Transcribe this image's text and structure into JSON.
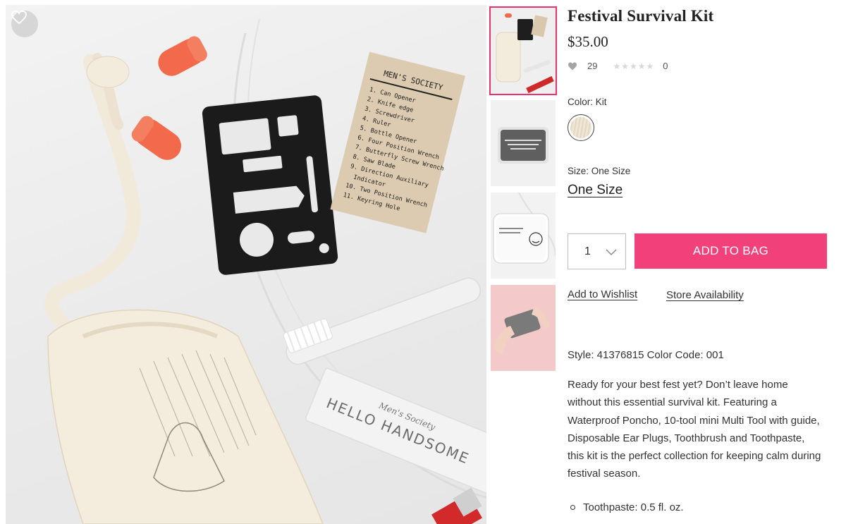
{
  "product": {
    "title": "Festival Survival Kit",
    "price": "$35.00",
    "likes": "29",
    "rating_stars": "★★★★★",
    "review_count": "0",
    "color_label": "Color: Kit",
    "size_label": "Size: One Size",
    "size_value": "One Size",
    "quantity": "1",
    "add_to_bag": "ADD TO BAG",
    "add_to_wishlist": "Add to Wishlist",
    "store_availability": "Store Availability",
    "style_line": "Style: 41376815 Color Code: 001",
    "description": "Ready for your best fest yet? Don’t leave home without this essential survival kit. Featuring a Waterproof Poncho, 10-tool mini Multi Tool with guide, Disposable Ear Plugs, Toothbrush and Toothpaste, this kit is the perfect collection for keeping calm during festival season.",
    "bullets": [
      "Toothpaste: 0.5 fl. oz."
    ]
  },
  "photo": {
    "card_title": "MEN'S SOCIETY",
    "card_items": [
      "1. Can Opener",
      "2. Knife edge",
      "3. Screwdriver",
      "4. Ruler",
      "5. Bottle Opener",
      "6. Four Position Wrench",
      "7. Butterfly Screw Wrench",
      "8. Saw Blade",
      "9. Direction Auxiliary",
      "Indicator",
      "10. Two Position Wrench",
      "11. Keyring Hole"
    ],
    "tube_script": "Men's Society",
    "tube_text": "HELLO HANDSOME",
    "thumb_kit_title": "THE FESTIVAL SURVIVAL KIT"
  },
  "colors": {
    "accent_pink": "#f2407b",
    "thumb_active_border": "#e8336f"
  },
  "icons": {
    "favorite": "heart-outline-icon",
    "likes": "heart-icon",
    "quantity": "chevron-down-icon",
    "color_swatch": "swatch-kit"
  }
}
